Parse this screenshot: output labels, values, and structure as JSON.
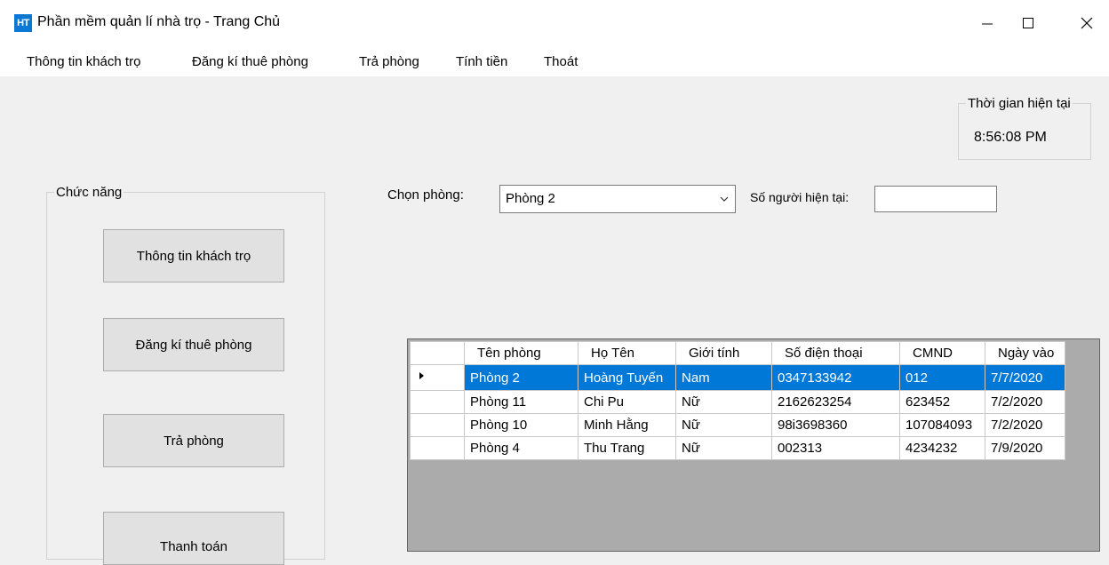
{
  "window": {
    "icon_text": "HT",
    "title": "Phần mềm quản lí nhà trọ - Trang Chủ"
  },
  "menu": [
    {
      "label": "Thông tin khách trọ"
    },
    {
      "label": "Đăng kí thuê phòng"
    },
    {
      "label": "Trả phòng"
    },
    {
      "label": "Tính tiền"
    },
    {
      "label": "Thoát"
    }
  ],
  "clock": {
    "legend": "Thời gian hiện tại",
    "time": "8:56:08 PM"
  },
  "functions": {
    "legend": "Chức năng",
    "buttons": [
      {
        "label": "Thông tin khách trọ"
      },
      {
        "label": "Đăng kí thuê phòng"
      },
      {
        "label": "Trả phòng"
      },
      {
        "label": "Thanh toán"
      }
    ]
  },
  "room_select": {
    "label": "Chọn phòng:",
    "value": "Phòng 2"
  },
  "occupants": {
    "label": "Số người hiện tại:",
    "value": ""
  },
  "grid": {
    "columns": [
      "Tên phòng",
      "Họ Tên",
      "Giới tính",
      "Số điện thoại",
      "CMND",
      "Ngày vào"
    ],
    "rows": [
      [
        "Phòng 2",
        "Hoàng Tuyến",
        "Nam",
        "0347133942",
        "012",
        "7/7/2020"
      ],
      [
        "Phòng 11",
        "Chi Pu",
        "Nữ",
        "2162623254",
        "623452",
        "7/2/2020"
      ],
      [
        "Phòng 10",
        "Minh Hằng",
        "Nữ",
        "98i3698360",
        "107084093",
        "7/2/2020"
      ],
      [
        "Phòng 4",
        "Thu Trang",
        "Nữ",
        "002313",
        "4234232",
        "7/9/2020"
      ]
    ]
  }
}
